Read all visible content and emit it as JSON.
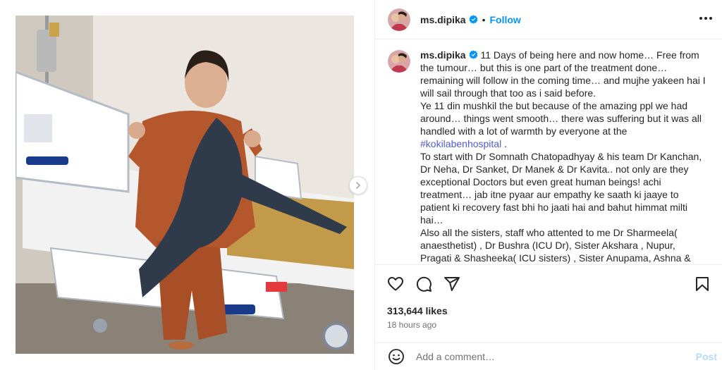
{
  "post": {
    "username": "ms.dipika",
    "follow_label": "Follow",
    "separator": "•",
    "caption": {
      "username": "ms.dipika",
      "part1": " 11 Days of being here and now home… Free from the tumour… but this is one part of the treatment done… remaining will follow in the coming time… and mujhe yakeen hai I will sail through that too as i said before.\nYe 11 din mushkil the but because of the amazing ppl we had around… things went smooth… there was suffering but it was all handled with a lot of warmth by everyone at the ",
      "hashtag": "#kokilabenhospital",
      "part2": " .\nTo start with Dr Somnath Chatopadhyay & his team Dr Kanchan, Dr Neha, Dr Sanket, Dr Manek & Dr Kavita.. not only are they exceptional Doctors but even great human beings! achi treatment… jab itne pyaar aur empathy ke saath ki jaaye to patient ki recovery fast bhi ho jaati hai and bahut himmat milti hai…\nAlso all the sisters, staff who attented to me Dr Sharmeela( anaesthetist) , Dr Bushra (ICU Dr), Sister Akshara , Nupur, Pragati & Shasheeka( ICU sisters) , Sister Anupama, Ashna & Sister Jijin"
    },
    "likes": "313,644 likes",
    "time": "18 hours ago",
    "comment_placeholder": "Add a comment…",
    "post_label": "Post"
  },
  "icons": {
    "verified": "verified-badge-icon",
    "more": "more-options-icon",
    "like": "heart-icon",
    "comment": "comment-icon",
    "share": "share-icon",
    "save": "bookmark-icon",
    "emoji": "emoji-icon",
    "next": "chevron-right-icon"
  },
  "colors": {
    "accent": "#0095f6",
    "verified": "#0095f6",
    "hashtag": "#4f5bd5",
    "post_disabled": "#b3dbff"
  }
}
